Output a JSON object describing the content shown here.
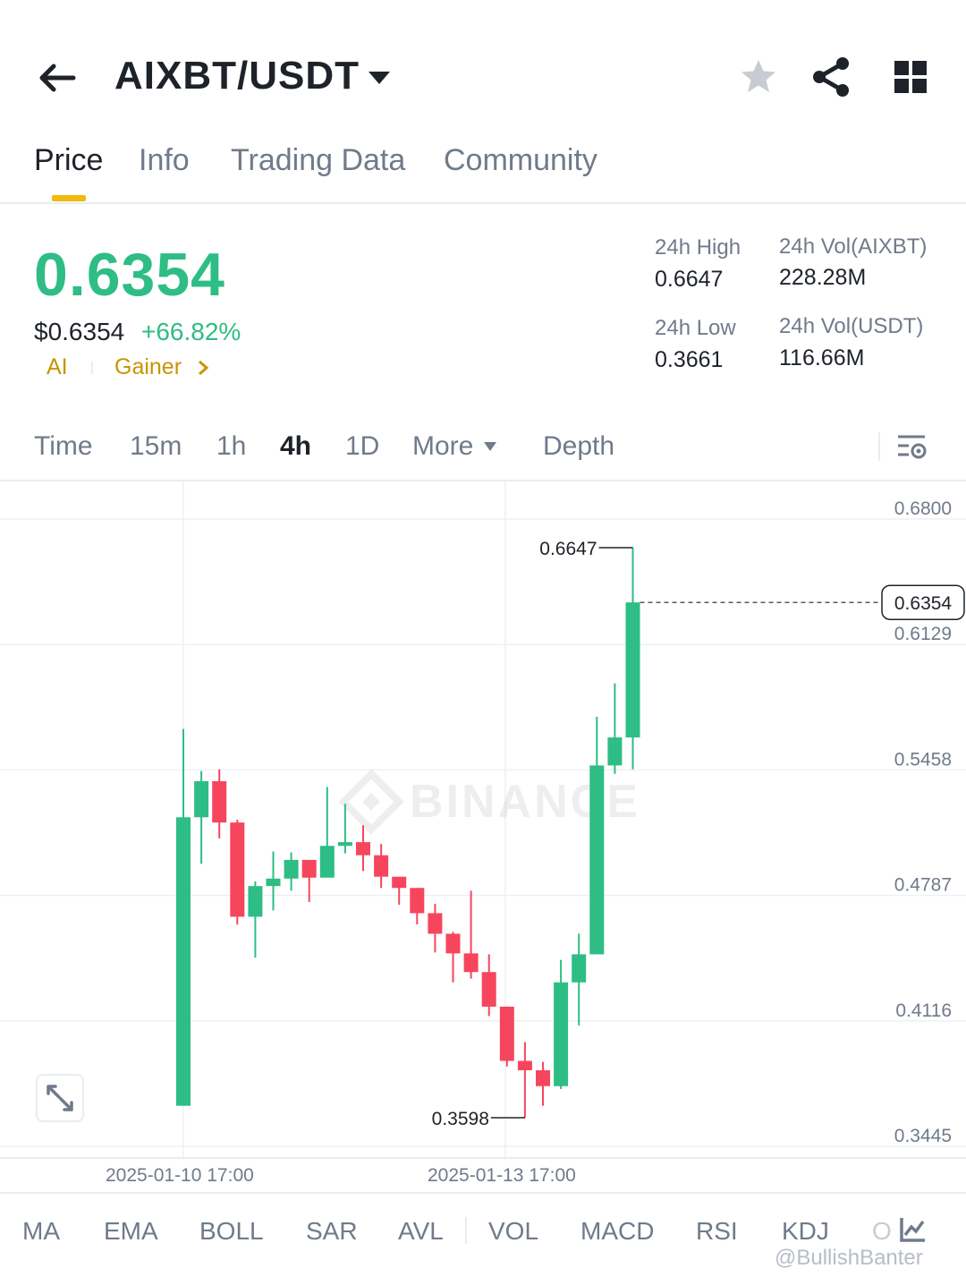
{
  "header": {
    "pair": "AIXBT/USDT",
    "icons": [
      "back-arrow-icon",
      "caret-down-icon",
      "star-icon",
      "share-icon",
      "grid-icon"
    ]
  },
  "tabs": [
    "Price",
    "Info",
    "Trading Data",
    "Community"
  ],
  "active_tab": "Price",
  "price": {
    "last": "0.6354",
    "usd": "$0.6354",
    "change": "+66.82%",
    "tags": [
      "AI",
      "Gainer"
    ]
  },
  "stats": {
    "high_label": "24h High",
    "high_value": "0.6647",
    "low_label": "24h Low",
    "low_value": "0.3661",
    "vol_base_label": "24h Vol(AIXBT)",
    "vol_base_value": "228.28M",
    "vol_quote_label": "24h Vol(USDT)",
    "vol_quote_value": "116.66M"
  },
  "timeframes": {
    "time": "Time",
    "m15": "15m",
    "h1": "1h",
    "h4": "4h",
    "d1": "1D",
    "more": "More",
    "depth": "Depth",
    "active": "4h"
  },
  "chart_data": {
    "type": "candlestick",
    "y_ticks": [
      "0.6800",
      "0.6129",
      "0.5458",
      "0.4787",
      "0.4116",
      "0.3445"
    ],
    "ylim": [
      0.3445,
      0.68
    ],
    "x_labels": [
      "2025-01-10 17:00",
      "2025-01-13 17:00"
    ],
    "current_price": "0.6354",
    "high_marker": "0.6647",
    "low_marker": "0.3598",
    "watermark": "BINANCE",
    "colors": {
      "up": "#2ebd85",
      "down": "#f6465d"
    },
    "candles": [
      {
        "o": 0.3662,
        "h": 0.5677,
        "l": 0.3662,
        "c": 0.5205
      },
      {
        "o": 0.5205,
        "h": 0.5452,
        "l": 0.4956,
        "c": 0.5398
      },
      {
        "o": 0.5398,
        "h": 0.5462,
        "l": 0.5092,
        "c": 0.5177
      },
      {
        "o": 0.5177,
        "h": 0.5192,
        "l": 0.4631,
        "c": 0.4673
      },
      {
        "o": 0.4673,
        "h": 0.4862,
        "l": 0.4454,
        "c": 0.4837
      },
      {
        "o": 0.4837,
        "h": 0.5022,
        "l": 0.4707,
        "c": 0.4877
      },
      {
        "o": 0.4877,
        "h": 0.5017,
        "l": 0.4812,
        "c": 0.4977
      },
      {
        "o": 0.4977,
        "h": 0.4977,
        "l": 0.4752,
        "c": 0.4882
      },
      {
        "o": 0.4882,
        "h": 0.5367,
        "l": 0.4902,
        "c": 0.5052
      },
      {
        "o": 0.5052,
        "h": 0.5277,
        "l": 0.5012,
        "c": 0.5072
      },
      {
        "o": 0.5072,
        "h": 0.5162,
        "l": 0.4917,
        "c": 0.5002
      },
      {
        "o": 0.5002,
        "h": 0.5062,
        "l": 0.4827,
        "c": 0.4887
      },
      {
        "o": 0.4887,
        "h": 0.4887,
        "l": 0.4737,
        "c": 0.4827
      },
      {
        "o": 0.4827,
        "h": 0.4827,
        "l": 0.4632,
        "c": 0.4692
      },
      {
        "o": 0.4692,
        "h": 0.4742,
        "l": 0.4482,
        "c": 0.4582
      },
      {
        "o": 0.4582,
        "h": 0.4592,
        "l": 0.4322,
        "c": 0.4477
      },
      {
        "o": 0.4477,
        "h": 0.4812,
        "l": 0.4342,
        "c": 0.4377
      },
      {
        "o": 0.4377,
        "h": 0.4472,
        "l": 0.4142,
        "c": 0.4192
      },
      {
        "o": 0.4192,
        "h": 0.4192,
        "l": 0.3872,
        "c": 0.3902
      },
      {
        "o": 0.3902,
        "h": 0.4002,
        "l": 0.3598,
        "c": 0.3852
      },
      {
        "o": 0.3852,
        "h": 0.3897,
        "l": 0.3662,
        "c": 0.3767
      },
      {
        "o": 0.3767,
        "h": 0.4442,
        "l": 0.3752,
        "c": 0.4322
      },
      {
        "o": 0.4322,
        "h": 0.4582,
        "l": 0.4092,
        "c": 0.4472
      },
      {
        "o": 0.4472,
        "h": 0.5742,
        "l": 0.4472,
        "c": 0.5482
      },
      {
        "o": 0.5482,
        "h": 0.5922,
        "l": 0.5437,
        "c": 0.5632
      },
      {
        "o": 0.5632,
        "h": 0.6647,
        "l": 0.5462,
        "c": 0.6354
      }
    ]
  },
  "indicators": [
    "MA",
    "EMA",
    "BOLL",
    "SAR",
    "AVL",
    "VOL",
    "MACD",
    "RSI",
    "KDJ",
    "O"
  ],
  "watermark_user": "@BullishBanter"
}
